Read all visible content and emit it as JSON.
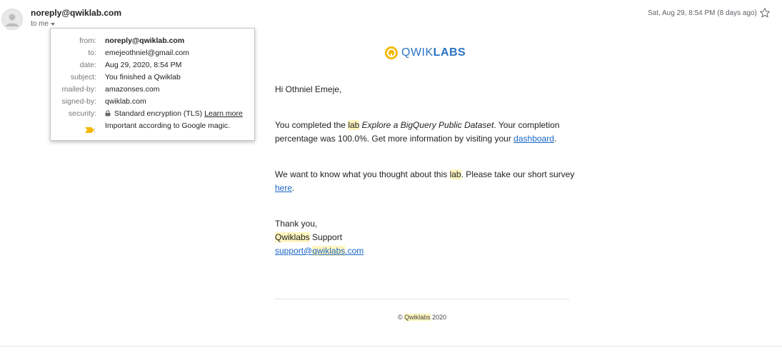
{
  "header": {
    "sender": "noreply@qwiklab.com",
    "to_label": "to me",
    "date": "Sat, Aug 29, 8:54 PM (8 days ago)"
  },
  "details": {
    "rows": [
      {
        "label": "from:",
        "value": "noreply@qwiklab.com"
      },
      {
        "label": "to:",
        "value": "emejeothniel@gmail.com"
      },
      {
        "label": "date:",
        "value": "Aug 29, 2020, 8:54 PM"
      },
      {
        "label": "subject:",
        "value": "You finished a Qwiklab"
      },
      {
        "label": "mailed-by:",
        "value": "amazonses.com"
      },
      {
        "label": "signed-by:",
        "value": "qwiklab.com"
      },
      {
        "label": "security:",
        "value": "Standard encryption (TLS)"
      }
    ],
    "learn_more": "Learn more",
    "important_text": "Important according to Google magic."
  },
  "body": {
    "logo_light": "QWIK",
    "logo_bold": "LABS",
    "greeting": "Hi Othniel Emeje,",
    "p1": {
      "a": "You completed the ",
      "lab": "lab",
      "b": " ",
      "course": "Explore a BigQuery Public Dataset",
      "c": ". Your completion percentage was 100.0%. Get more information by visiting your ",
      "link": "dashboard",
      "d": "."
    },
    "p2": {
      "a": "We want to know what you thought about this ",
      "lab": "lab",
      "b": ". Please take our short survey ",
      "link": "here",
      "c": "."
    },
    "signoff": {
      "thanks": "Thank you,",
      "brand": "Qwiklabs",
      "support": " Support",
      "email_a": "support@",
      "email_b": "qwiklabs",
      "email_c": ".com"
    },
    "footer": {
      "copy": "© ",
      "brand": "Qwiklabs",
      "year": " 2020"
    }
  },
  "colors": {
    "accent_yellow": "#f5b800",
    "link_blue": "#1a66c7",
    "logo_blue": "#2a73c3",
    "highlight": "#fff6bf"
  }
}
